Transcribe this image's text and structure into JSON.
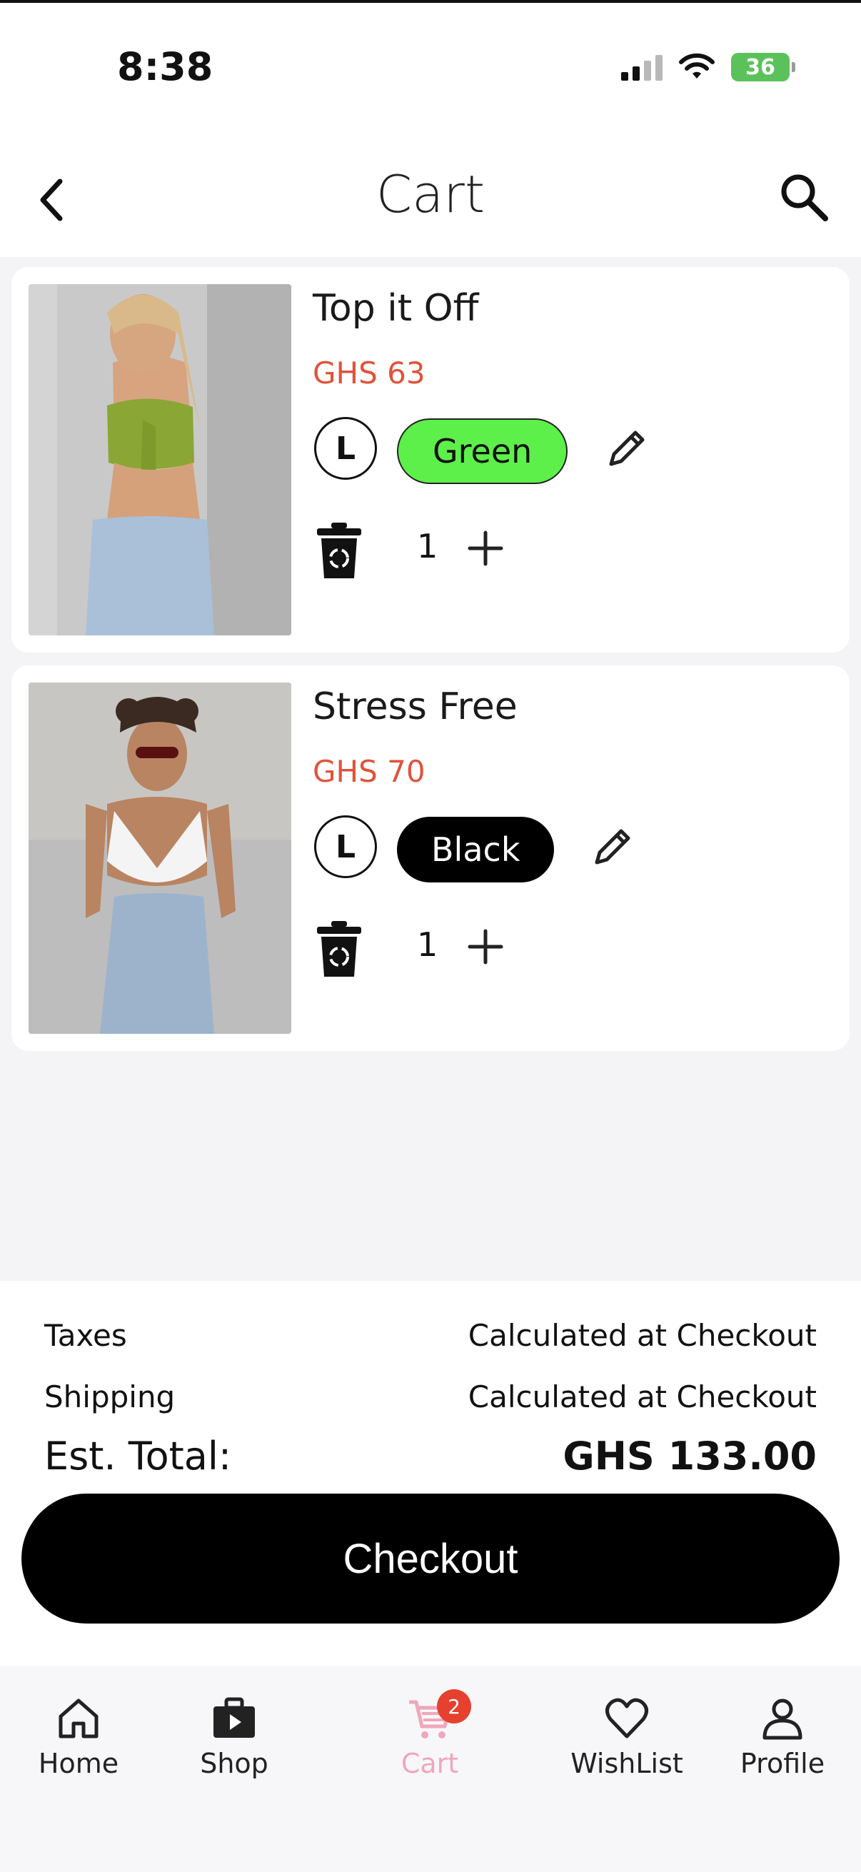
{
  "status_bar": {
    "time": "8:38",
    "battery": "36"
  },
  "header": {
    "title": "Cart"
  },
  "cart_items": [
    {
      "name": "Top it Off",
      "price": "GHS 63",
      "size": "L",
      "color": "Green",
      "quantity": "1",
      "chip_bg": "#5df04a",
      "chip_text": "#111111"
    },
    {
      "name": "Stress Free",
      "price": "GHS 70",
      "size": "L",
      "color": "Black",
      "quantity": "1",
      "chip_bg": "#000000",
      "chip_text": "#ffffff"
    }
  ],
  "summary": {
    "taxes_label": "Taxes",
    "taxes_value": "Calculated at Checkout",
    "shipping_label": "Shipping",
    "shipping_value": "Calculated at Checkout",
    "total_label": "Est. Total:",
    "total_value": "GHS 133.00",
    "checkout_label": "Checkout"
  },
  "tabs": [
    {
      "label": "Home",
      "icon": "home-icon"
    },
    {
      "label": "Shop",
      "icon": "shop-icon"
    },
    {
      "label": "Cart",
      "icon": "cart-icon",
      "badge": "2",
      "active": true
    },
    {
      "label": "WishList",
      "icon": "heart-icon"
    },
    {
      "label": "Profile",
      "icon": "profile-icon"
    }
  ],
  "colors": {
    "price": "#e0533b",
    "active_tab": "#f0a6bb",
    "badge": "#e5412e"
  }
}
